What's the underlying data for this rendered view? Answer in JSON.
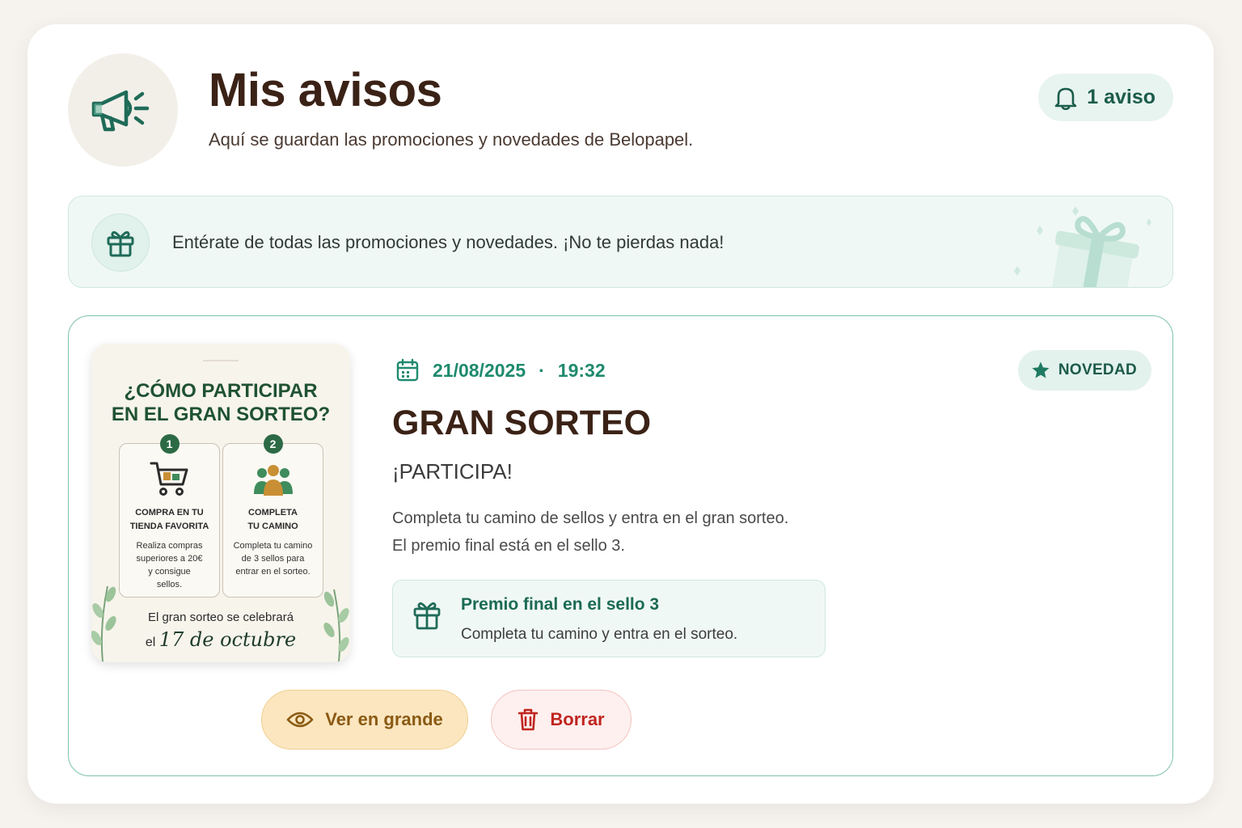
{
  "header": {
    "icon": "megaphone-icon",
    "title": "Mis avisos",
    "subtitle": "Aquí se guardan las promociones y novedades de Belopapel.",
    "count_icon": "bell-icon",
    "count_label": "1 aviso"
  },
  "banner": {
    "icon": "gift-icon",
    "text": "Entérate de todas las promociones y novedades. ¡No te pierdas nada!",
    "decoration": "gift-box-illustration"
  },
  "notice": {
    "date_icon": "calendar-icon",
    "date": "21/08/2025",
    "separator": "·",
    "time": "19:32",
    "tag_icon": "star-icon",
    "tag": "NOVEDAD",
    "title": "GRAN SORTEO",
    "subtitle": "¡PARTICIPA!",
    "body_line1": "Completa tu camino de sellos y entra en el gran sorteo.",
    "body_line2": "El premio final está en el sello 3.",
    "prize": {
      "icon": "gift-icon",
      "title": "Premio final en el sello 3",
      "text": "Completa tu camino y entra en el sorteo."
    },
    "poster": {
      "title_line1": "¿CÓMO PARTICIPAR",
      "title_line2": "EN EL GRAN SORTEO?",
      "steps": [
        {
          "number": "1",
          "icon": "shopping-cart-icon",
          "title_line1": "COMPRA EN TU",
          "title_line2": "TIENDA FAVORITA",
          "text_line1": "Realiza compras",
          "text_line2": "superiores a 20€",
          "text_line3": "y consigue",
          "text_line4": "sellos."
        },
        {
          "number": "2",
          "icon": "people-group-icon",
          "title_line1": "COMPLETA",
          "title_line2": "TU CAMINO",
          "text_line1": "Completa tu camino",
          "text_line2": "de 3 sellos para",
          "text_line3": "entrar en el sorteo."
        }
      ],
      "footer_line1": "El gran sorteo se celebrará",
      "footer_prefix": "el",
      "footer_date": "17 de octubre"
    },
    "actions": {
      "view_icon": "eye-icon",
      "view_label": "Ver en grande",
      "delete_icon": "trash-icon",
      "delete_label": "Borrar"
    }
  },
  "colors": {
    "brand_dark": "#3b2216",
    "accent_green": "#1f8a6e",
    "view_button": "#fbe6c0",
    "delete_button": "#fdf0ef",
    "delete_text": "#c0251f"
  }
}
